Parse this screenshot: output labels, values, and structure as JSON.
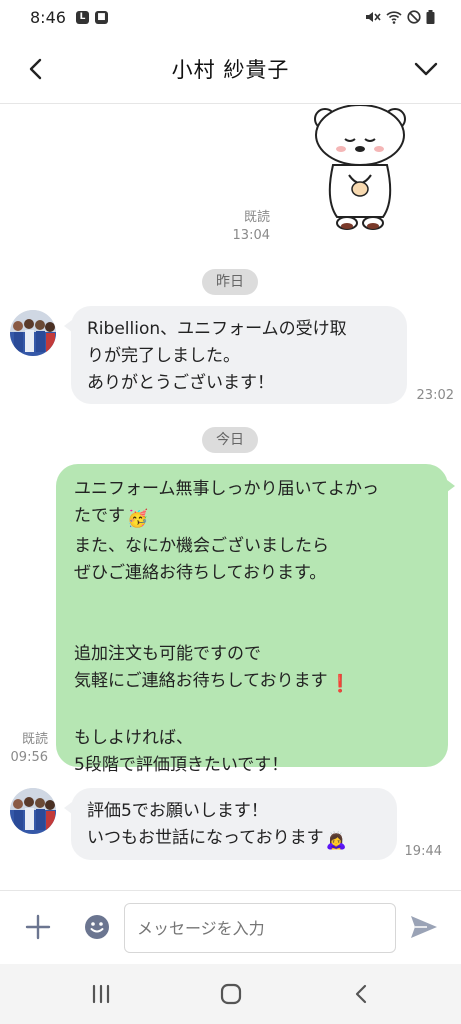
{
  "status_bar": {
    "time": "8:46",
    "notification_icons": [
      "line-notification-icon",
      "app-notification-icon"
    ],
    "system_icons": [
      "mute-icon",
      "wifi-icon",
      "do-not-disturb-icon",
      "battery-icon"
    ]
  },
  "header": {
    "title": "小村 紗貴子",
    "back_icon": "back-chevron-icon",
    "menu_icon": "chevron-down-icon"
  },
  "messages": {
    "sticker": {
      "description_icon": "bear-bowing-sticker",
      "read": "既読",
      "time": "13:04"
    },
    "date_yesterday": "昨日",
    "incoming_1": {
      "lines": [
        "Ribellion、ユニフォームの受け取",
        "りが完了しました。",
        "ありがとうございます！"
      ],
      "time": "23:02"
    },
    "date_today": "今日",
    "outgoing_1": {
      "lines": [
        "ユニフォーム無事しっかり届いてよかっ",
        "たです",
        "また、なにか機会ございましたら",
        "ぜひご連絡お待ちしております。",
        "",
        "",
        "追加注文も可能ですので",
        "気軽にご連絡お待ちしております",
        "",
        "もしよければ、",
        "5段階で評価頂きたいです！"
      ],
      "emoji_party": "🥳",
      "emoji_exclamation": "❗",
      "read": "既読",
      "time": "09:56"
    },
    "incoming_2": {
      "lines": [
        "評価5でお願いします！",
        "いつもお世話になっております"
      ],
      "emoji_bow": "🙇‍♀️",
      "time": "19:44"
    }
  },
  "input_bar": {
    "placeholder": "メッセージを入力",
    "add_icon": "plus-icon",
    "emoji_icon": "smiley-icon",
    "send_icon": "send-icon"
  },
  "nav_bar": {
    "icons": [
      "recent-apps-icon",
      "home-icon",
      "back-icon"
    ]
  },
  "colors": {
    "outgoing_bubble": "#b6e6b3",
    "incoming_bubble": "#f0f1f3",
    "date_pill": "#dcdcdc",
    "accent_icon": "#9aa3b6"
  }
}
